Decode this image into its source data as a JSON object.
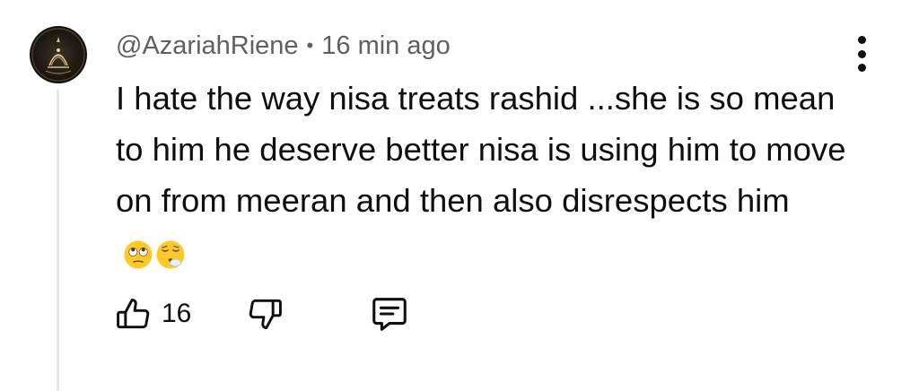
{
  "comment": {
    "author": "@AzariahRiene",
    "separator": "•",
    "time": "16 min ago",
    "text": "I hate the way nisa treats rashid ...she is so mean to him he deserve better nisa is using him to move on from meeran and then also disrespects him",
    "emojis": [
      "face-with-rolling-eyes",
      "face-exhaling"
    ]
  },
  "actions": {
    "like_count": "16",
    "icons": [
      "thumbs-up-icon",
      "thumbs-down-icon",
      "reply-icon",
      "more-vert-icon"
    ]
  },
  "colors": {
    "primary_text": "#0f0f0f",
    "secondary_text": "#606060",
    "thread_line": "#e7e7e7",
    "emoji_yellow": "#ffca28"
  }
}
